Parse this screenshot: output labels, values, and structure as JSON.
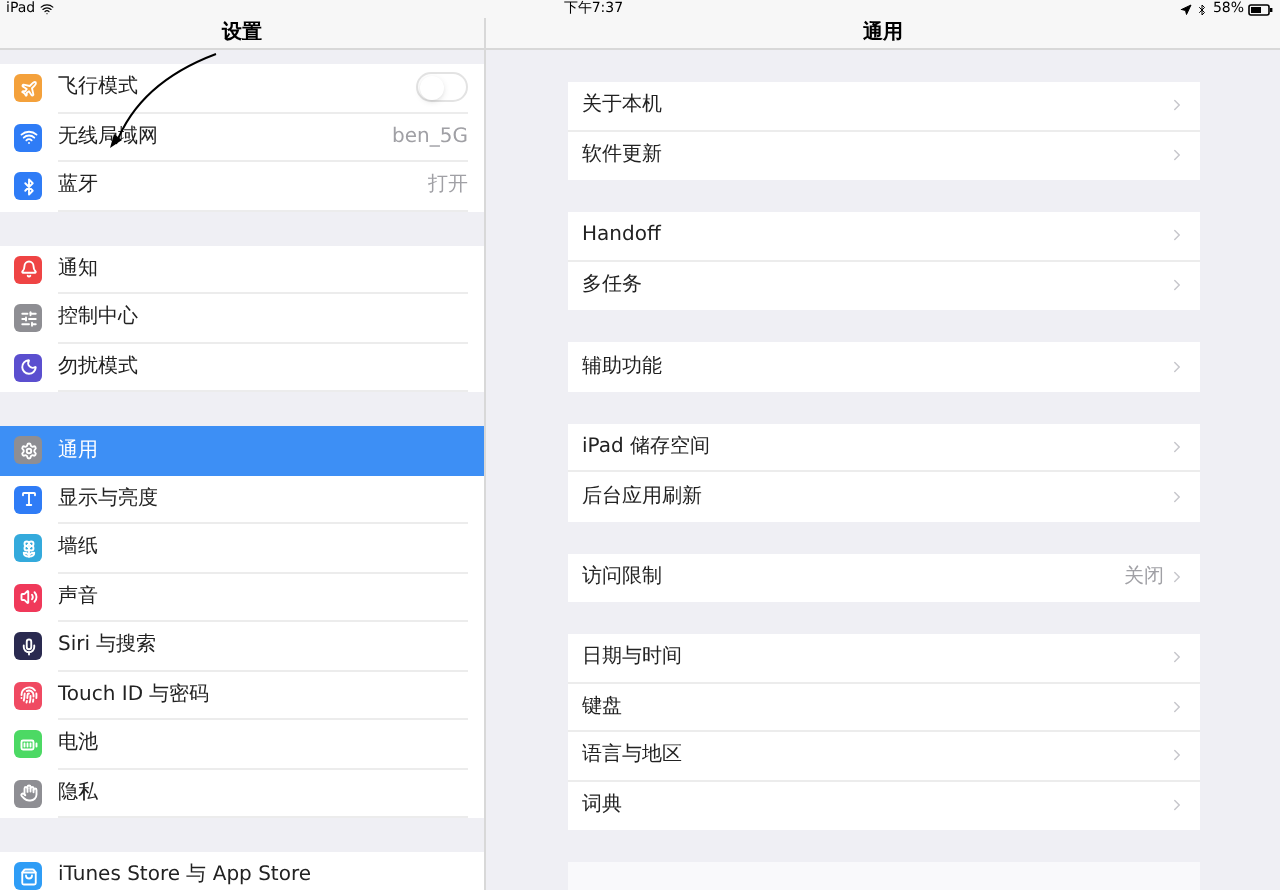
{
  "status_bar": {
    "device": "iPad",
    "time": "下午7:37",
    "battery": "58%"
  },
  "sidebar": {
    "title": "设置",
    "groups": [
      [
        {
          "label": "飞行模式",
          "kind": "toggle",
          "on": false,
          "selected": false,
          "color": "#f4a13b"
        },
        {
          "label": "无线局域网",
          "kind": "value",
          "value": "ben_5G",
          "selected": false,
          "color": "#2f7cf6"
        },
        {
          "label": "蓝牙",
          "kind": "value",
          "value": "打开",
          "selected": false,
          "color": "#2f7cf6"
        }
      ],
      [
        {
          "label": "通知",
          "kind": "plain",
          "selected": false,
          "color": "#ef4444"
        },
        {
          "label": "控制中心",
          "kind": "plain",
          "selected": false,
          "color": "#8e8e93"
        },
        {
          "label": "勿扰模式",
          "kind": "plain",
          "selected": false,
          "color": "#5b4fcf"
        }
      ],
      [
        {
          "label": "通用",
          "kind": "plain",
          "selected": true,
          "color": "#8e8e93"
        },
        {
          "label": "显示与亮度",
          "kind": "plain",
          "selected": false,
          "color": "#2f7cf6"
        },
        {
          "label": "墙纸",
          "kind": "plain",
          "selected": false,
          "color": "#34aadc"
        },
        {
          "label": "声音",
          "kind": "plain",
          "selected": false,
          "color": "#f0395a"
        },
        {
          "label": "Siri 与搜索",
          "kind": "plain",
          "selected": false,
          "color": "#2a2a50"
        },
        {
          "label": "Touch ID 与密码",
          "kind": "plain",
          "selected": false,
          "color": "#f04a62"
        },
        {
          "label": "电池",
          "kind": "plain",
          "selected": false,
          "color": "#4cd964"
        },
        {
          "label": "隐私",
          "kind": "plain",
          "selected": false,
          "color": "#8e8e93"
        }
      ],
      [
        {
          "label": "iTunes Store 与 App Store",
          "kind": "plain",
          "selected": false,
          "color": "#2f9df6"
        }
      ]
    ]
  },
  "detail": {
    "title": "通用",
    "groups": [
      [
        {
          "label": "关于本机"
        },
        {
          "label": "软件更新"
        }
      ],
      [
        {
          "label": "Handoff"
        },
        {
          "label": "多任务"
        }
      ],
      [
        {
          "label": "辅助功能"
        }
      ],
      [
        {
          "label": "iPad 储存空间"
        },
        {
          "label": "后台应用刷新"
        }
      ],
      [
        {
          "label": "访问限制",
          "value": "关闭"
        }
      ],
      [
        {
          "label": "日期与时间"
        },
        {
          "label": "键盘"
        },
        {
          "label": "语言与地区"
        },
        {
          "label": "词典"
        }
      ]
    ]
  }
}
